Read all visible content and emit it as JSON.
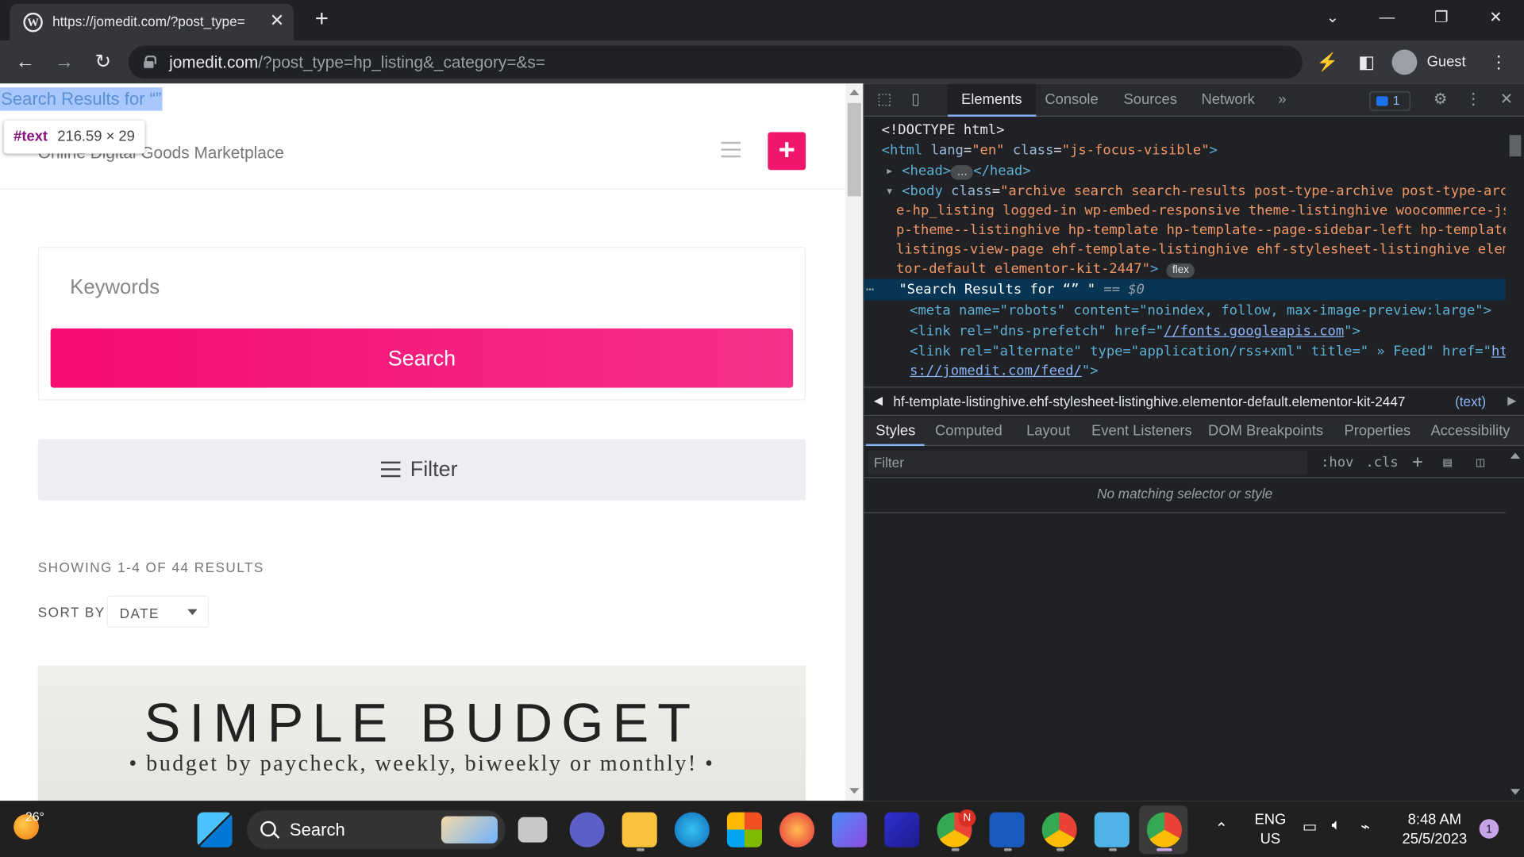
{
  "browser": {
    "tab_title": "https://jomedit.com/?post_type=",
    "url_host": "jomedit.com",
    "url_path": "/?post_type=hp_listing&_category=&s=",
    "profile_label": "Guest"
  },
  "page": {
    "selected_heading": "Search Results for “”",
    "inspect_tooltip": {
      "node": "#text",
      "size": "216.59 × 29"
    },
    "site_tagline": "Online Digital Goods Marketplace",
    "keywords_placeholder": "Keywords",
    "search_button": "Search",
    "filter_button": "Filter",
    "results_count": "SHOWING 1-4 OF 44 RESULTS",
    "sort_label": "SORT BY",
    "sort_value": "DATE",
    "listing_image_title": "SIMPLE BUDGET",
    "listing_image_subtitle": "• budget by paycheck, weekly, biweekly or monthly! •",
    "accent_color": "#f0166e"
  },
  "devtools": {
    "tabs": [
      "Elements",
      "Console",
      "Sources",
      "Network"
    ],
    "more_tabs": "»",
    "issues_count": "1",
    "dom": {
      "doctype": "<!DOCTYPE html>",
      "html_open": "<html",
      "html_attr_lang": "lang",
      "html_val_lang": "\"en\"",
      "html_attr_class": "class",
      "html_val_class": "\"js-focus-visible\"",
      "html_close": ">",
      "head_open": "<head>",
      "head_ellipsis": "…",
      "head_close": "</head>",
      "body_open": "<body",
      "body_attr_class": "class",
      "body_class_1": "\"archive search search-results post-type-archive post-type-archiv",
      "body_class_2": "e-hp_listing logged-in wp-embed-responsive theme-listinghive woocommerce-js h",
      "body_class_3": "p-theme--listinghive hp-template hp-template--page-sidebar-left hp-template--",
      "body_class_4": "listings-view-page ehf-template-listinghive ehf-stylesheet-listinghive elemen",
      "body_class_5": "tor-default elementor-kit-2447\"",
      "body_close": ">",
      "body_badge": "flex",
      "selected_node": "\"Search Results for “” \"",
      "selected_suffix": "== $0",
      "meta_line": "<meta name=\"robots\" content=\"noindex, follow, max-image-preview:large\">",
      "link1_prefix": "<link rel=\"dns-prefetch\" href=\"",
      "link1_href": "//fonts.googleapis.com",
      "link1_suffix": "\">",
      "link2_prefix": "<link rel=\"alternate\" type=\"application/rss+xml\" title=\" » Feed\" href=\"",
      "link2_href_a": "http",
      "link2_href_b": "s://jomedit.com/feed/",
      "link2_suffix": "\">"
    },
    "breadcrumb": "hf-template-listinghive.ehf-stylesheet-listinghive.elementor-default.elementor-kit-2447",
    "breadcrumb_end": "(text)",
    "sub_tabs": [
      "Styles",
      "Computed",
      "Layout",
      "Event Listeners",
      "DOM Breakpoints",
      "Properties",
      "Accessibility"
    ],
    "filter_placeholder": "Filter",
    "hov": ":hov",
    "cls": ".cls",
    "no_match": "No matching selector or style"
  },
  "taskbar": {
    "temperature": "26°",
    "search_label": "Search",
    "chrome_badge": "N",
    "lang_top": "ENG",
    "lang_bottom": "US",
    "time": "8:48 AM",
    "date": "25/5/2023",
    "notification_count": "1"
  }
}
